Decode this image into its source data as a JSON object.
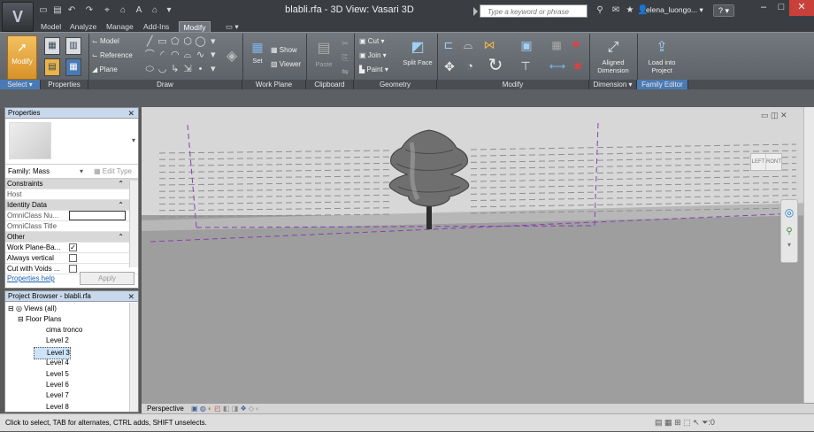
{
  "window": {
    "title": "blabli.rfa - 3D View: Vasari 3D",
    "search_placeholder": "Type a keyword or phrase",
    "user": "elena_luongo... ▾",
    "help": "? ▾",
    "app_logo": "V"
  },
  "tabs": [
    "Model",
    "Analyze",
    "Manage",
    "Add-Ins",
    "Modify"
  ],
  "active_tab": "Modify",
  "ribbon": {
    "select": {
      "modify_label": "Modify"
    },
    "draw": {
      "model": "Model",
      "reference": "Reference",
      "plane": "Plane"
    },
    "work_plane": {
      "set": "Set",
      "show": "Show",
      "viewer": "Viewer"
    },
    "clipboard": {
      "paste": "Paste"
    },
    "geometry": {
      "cut": "Cut ▾",
      "join": "Join ▾",
      "paint": "Paint ▾",
      "split_face": "Split Face"
    },
    "dimension": {
      "aligned": "Aligned",
      "dimension": "Dimension"
    },
    "family_editor": {
      "load1": "Load into",
      "load2": "Project"
    },
    "panel_labels": {
      "select": "Select ▾",
      "properties": "Properties",
      "draw": "Draw",
      "work_plane": "Work Plane",
      "clipboard": "Clipboard",
      "geometry": "Geometry",
      "modify": "Modify",
      "dimension": "Dimension ▾",
      "family_editor": "Family Editor"
    }
  },
  "properties": {
    "title": "Properties",
    "family_selector": "Family: Mass",
    "edit_type": "Edit Type",
    "rows": [
      {
        "key": "Constraints",
        "section": true
      },
      {
        "key": "Host",
        "value": ""
      },
      {
        "key": "Identity Data",
        "section": true
      },
      {
        "key": "OmniClass Nu...",
        "value": ""
      },
      {
        "key": "OmniClass Title",
        "value": ""
      },
      {
        "key": "Other",
        "section": true
      },
      {
        "key": "Work Plane-Ba...",
        "checked": true
      },
      {
        "key": "Always vertical",
        "checked": false
      },
      {
        "key": "Cut with Voids ...",
        "checked": false
      }
    ],
    "help_link": "Properties help",
    "apply": "Apply"
  },
  "project_browser": {
    "title": "Project Browser - blabli.rfa",
    "views": "Views (all)",
    "floor_plans": "Floor Plans",
    "items": [
      "cima tronco",
      "Level 2",
      "Level 3",
      "Level 4",
      "Level 5",
      "Level 6",
      "Level 7",
      "Level 8"
    ],
    "selected": "Level 3"
  },
  "viewport": {
    "view_mode": "Perspective",
    "viewcube_left": "LEFT",
    "viewcube_front": "RONT"
  },
  "status": {
    "message": "Click to select, TAB for alternates, CTRL adds, SHIFT unselects.",
    "filter_count": ":0"
  },
  "colors": {
    "accent": "#4a7ab3",
    "modify_button": "#e3a23e",
    "dashed_plane": "#8a3fb0"
  }
}
